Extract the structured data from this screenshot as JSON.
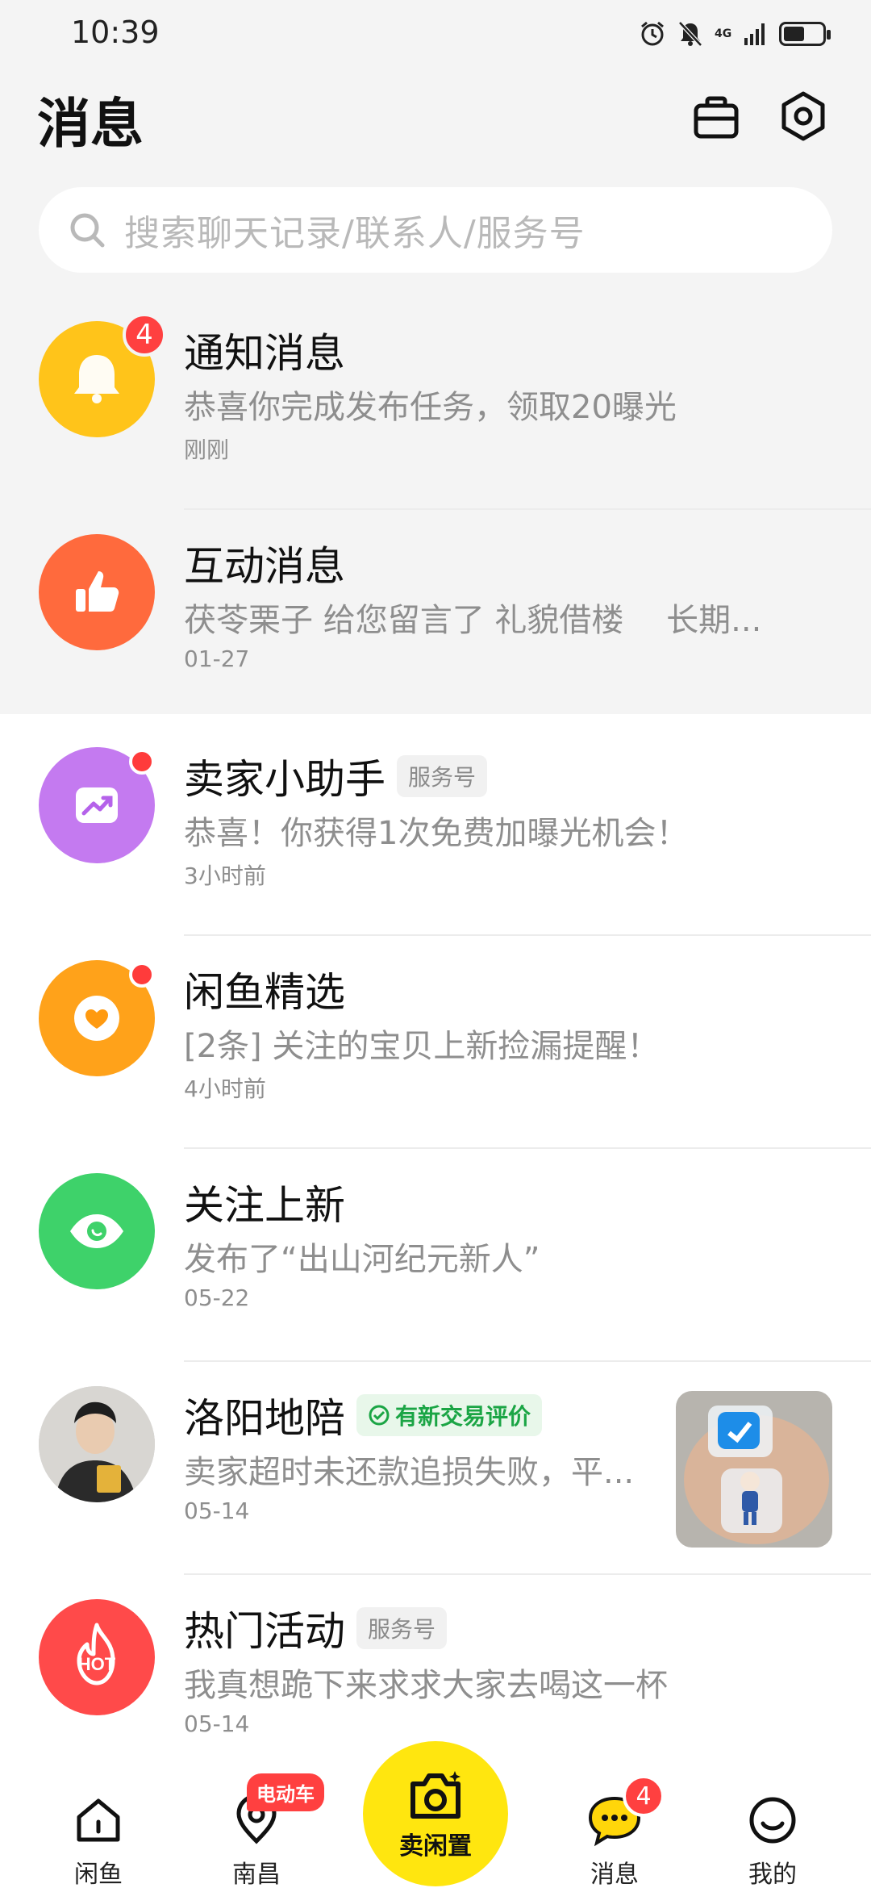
{
  "status_bar": {
    "time": "10:39",
    "network": "4G",
    "icons": [
      "alarm-icon",
      "bell-muted-icon",
      "signal-icon",
      "battery-icon"
    ],
    "battery_level": 0.55
  },
  "header": {
    "title": "消息",
    "actions": [
      "bag-icon",
      "settings-icon"
    ]
  },
  "search": {
    "placeholder": "搜索聊天记录/联系人/服务号"
  },
  "messages": [
    {
      "title": "通知消息",
      "subtitle": "恭喜你完成发布任务，领取20曝光",
      "time": "刚刚",
      "badge_count": "4",
      "icon": "bell-icon",
      "color": "#ffc41a"
    },
    {
      "title": "互动消息",
      "subtitle": "茯苓栗子 给您留言了 礼貌借楼　 长期...",
      "time": "01-27",
      "icon": "thumbs-up-icon",
      "color": "#ff6a3d"
    },
    {
      "title": "卖家小助手",
      "tag": "服务号",
      "subtitle": "恭喜！你获得1次免费加曝光机会！",
      "time": "3小时前",
      "unread_dot": true,
      "icon": "trend-up-icon",
      "color": "#c47af0"
    },
    {
      "title": "闲鱼精选",
      "subtitle": "[2条] 关注的宝贝上新捡漏提醒！",
      "time": "4小时前",
      "unread_dot": true,
      "icon": "heart-icon",
      "color": "#ffa21a"
    },
    {
      "title": "关注上新",
      "subtitle": "发布了“出山河纪元新人”",
      "time": "05-22",
      "icon": "eye-icon",
      "color": "#3ed26a"
    },
    {
      "title": "洛阳地陪",
      "tag": "有新交易评价",
      "subtitle": "卖家超时未还款追损失败，平...",
      "time": "05-14",
      "icon": "user-avatar",
      "has_thumbnail": true
    },
    {
      "title": "热门活动",
      "tag": "服务号",
      "subtitle": "我真想跪下来求求大家去喝这一杯",
      "time": "05-14",
      "icon": "hot-flame-icon",
      "color": "#ff4a4a",
      "avatar_text": "HOT"
    }
  ],
  "bottom_nav": {
    "items": [
      {
        "label": "闲鱼",
        "icon": "home-icon"
      },
      {
        "label": "南昌",
        "icon": "location-pin-icon",
        "tag": "电动车"
      },
      {
        "label": "卖闲置",
        "icon": "camera-icon"
      },
      {
        "label": "消息",
        "icon": "chat-bubble-icon",
        "badge": "4"
      },
      {
        "label": "我的",
        "icon": "smile-face-icon"
      }
    ]
  }
}
